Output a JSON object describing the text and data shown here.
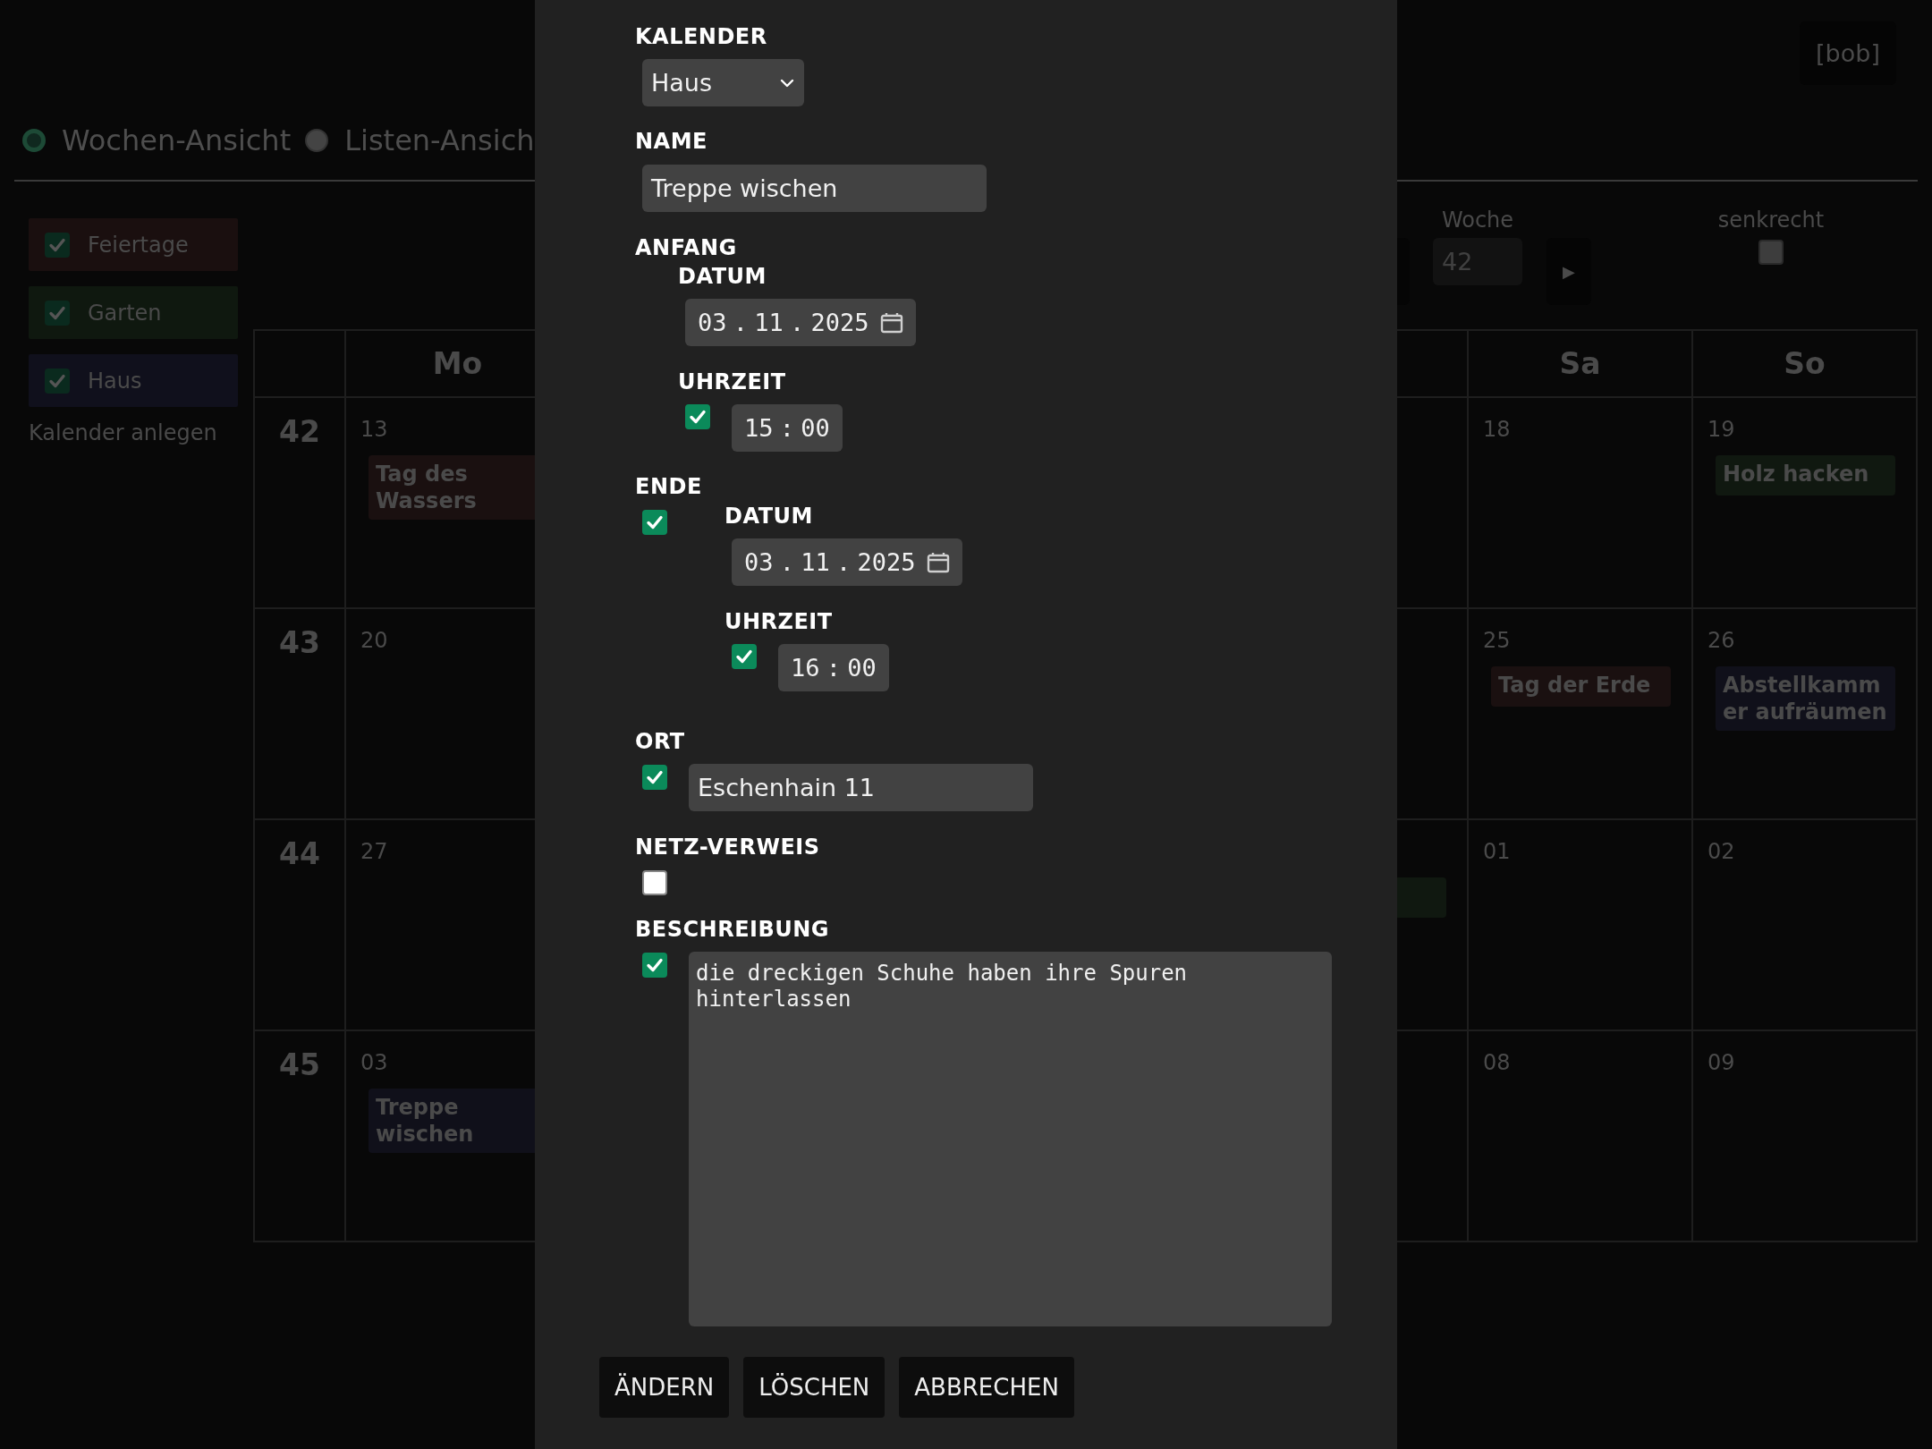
{
  "header": {
    "user_button": "[bob]"
  },
  "view_modes": [
    {
      "label": "Wochen-Ansicht",
      "selected": true
    },
    {
      "label": "Listen-Ansich",
      "selected": false
    }
  ],
  "calendars": [
    {
      "label": "Feiertage",
      "checked": true,
      "color": "#1a0f0f"
    },
    {
      "label": "Garten",
      "checked": true,
      "color": "#0f180f"
    },
    {
      "label": "Haus",
      "checked": true,
      "color": "#10101c"
    }
  ],
  "create_calendar_link": "Kalender anlegen",
  "week_nav": {
    "week_label": "Woche",
    "week_value": "42",
    "next_button": "▶",
    "vertical_label": "senkrecht",
    "vertical": false
  },
  "week_grid": {
    "week_numbers": [
      "42",
      "43",
      "44",
      "45"
    ],
    "columns": [
      {
        "heading": "Mo",
        "cells": [
          {
            "day": "13",
            "events": [
              {
                "title": "Tag des Wassers",
                "color": "#1a1010"
              }
            ]
          },
          {
            "day": "20"
          },
          {
            "day": "27"
          },
          {
            "day": "03",
            "events": [
              {
                "title": "Treppe wischen",
                "color": "#10101a"
              }
            ]
          }
        ]
      },
      {},
      {},
      {},
      {
        "cells": [
          {},
          {},
          {
            "events": [
              {
                "color": "#101810"
              }
            ]
          },
          {}
        ]
      },
      {
        "heading": "Sa",
        "cells": [
          {
            "day": "18"
          },
          {
            "day": "25",
            "events": [
              {
                "title": "Tag der Erde",
                "color": "#1a1010"
              }
            ]
          },
          {
            "day": "01"
          },
          {
            "day": "08"
          }
        ]
      },
      {
        "heading": "So",
        "cells": [
          {
            "day": "19",
            "events": [
              {
                "title": "Holz hacken",
                "color": "#101810"
              }
            ]
          },
          {
            "day": "26",
            "events": [
              {
                "title": "Abstellkammer aufräumen",
                "color": "#10101a"
              }
            ]
          },
          {
            "day": "02"
          },
          {
            "day": "09"
          }
        ]
      }
    ]
  },
  "event_dialog": {
    "calendar": {
      "label": "KALENDER",
      "value": "Haus"
    },
    "name": {
      "label": "NAME",
      "value": "Treppe wischen"
    },
    "start": {
      "label": "ANFANG",
      "date_label": "DATUM",
      "date": "03 . 11 . 2025",
      "time_label": "UHRZEIT",
      "time_enabled": true,
      "time": "15 : 00"
    },
    "end": {
      "label": "ENDE",
      "enabled": true,
      "date_label": "DATUM",
      "date": "03 . 11 . 2025",
      "time_label": "UHRZEIT",
      "time_enabled": true,
      "time": "16 : 00"
    },
    "location": {
      "label": "ORT",
      "enabled": true,
      "value": "Eschenhain 11"
    },
    "link": {
      "label": "NETZ-VERWEIS",
      "enabled": false
    },
    "description": {
      "label": "BESCHREIBUNG",
      "enabled": true,
      "value": "die dreckigen Schuhe haben ihre Spuren hinterlassen"
    },
    "buttons": [
      "ÄNDERN",
      "LÖSCHEN",
      "ABBRECHEN"
    ]
  }
}
